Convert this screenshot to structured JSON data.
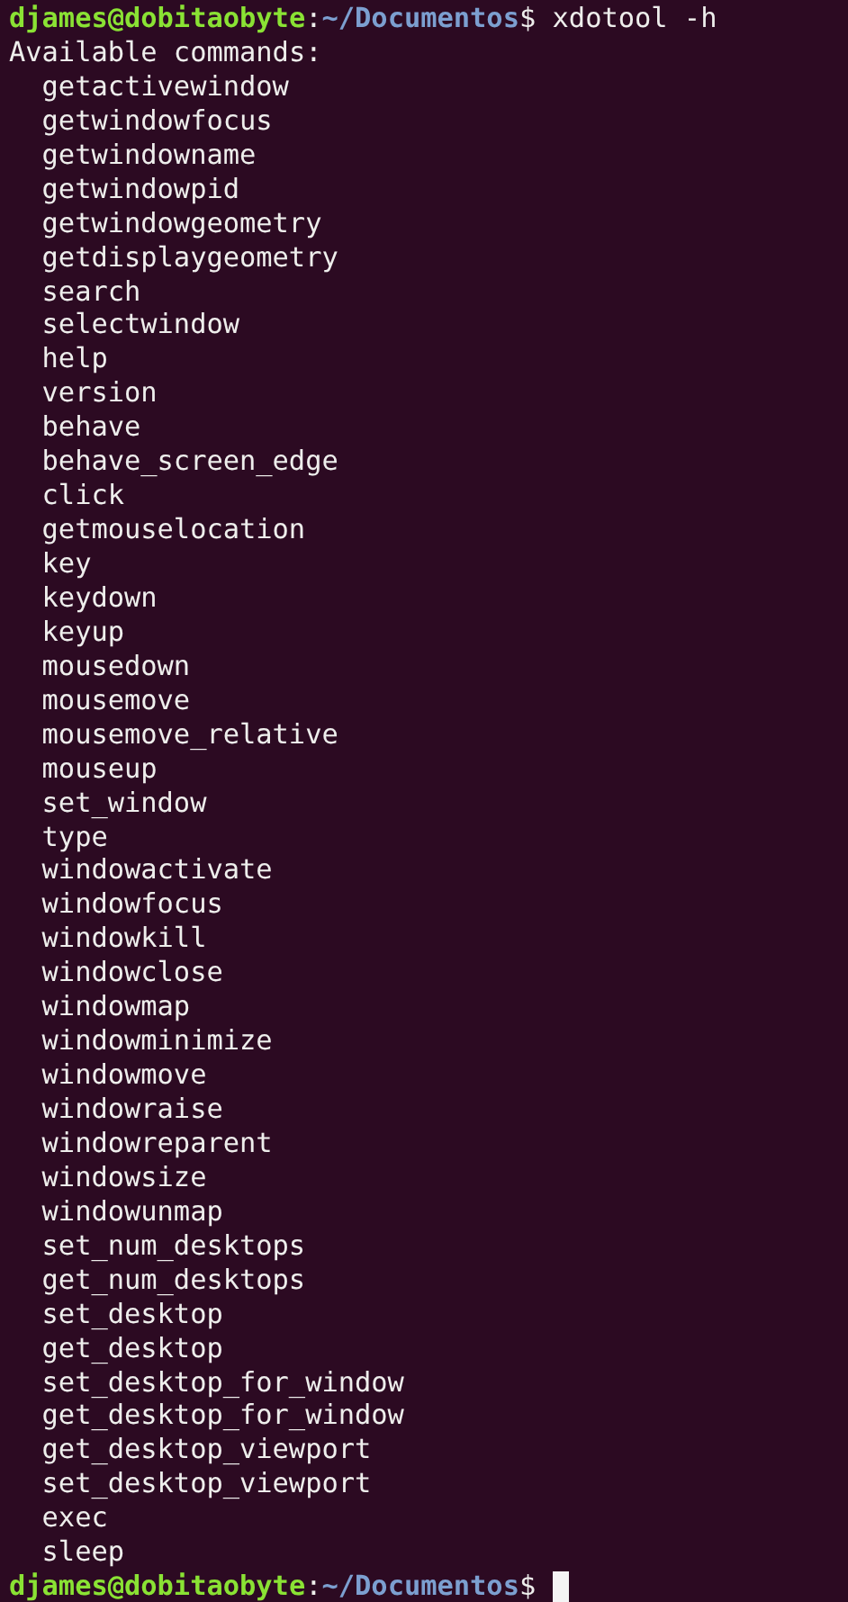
{
  "prompts": [
    {
      "user_host": "djames@dobitaobyte",
      "separator": ":",
      "path": "~/Documentos",
      "symbol": "$",
      "command": "xdotool -h"
    }
  ],
  "output_heading": "Available commands:",
  "commands": [
    "getactivewindow",
    "getwindowfocus",
    "getwindowname",
    "getwindowpid",
    "getwindowgeometry",
    "getdisplaygeometry",
    "search",
    "selectwindow",
    "help",
    "version",
    "behave",
    "behave_screen_edge",
    "click",
    "getmouselocation",
    "key",
    "keydown",
    "keyup",
    "mousedown",
    "mousemove",
    "mousemove_relative",
    "mouseup",
    "set_window",
    "type",
    "windowactivate",
    "windowfocus",
    "windowkill",
    "windowclose",
    "windowmap",
    "windowminimize",
    "windowmove",
    "windowraise",
    "windowreparent",
    "windowsize",
    "windowunmap",
    "set_num_desktops",
    "get_num_desktops",
    "set_desktop",
    "get_desktop",
    "set_desktop_for_window",
    "get_desktop_for_window",
    "get_desktop_viewport",
    "set_desktop_viewport",
    "exec",
    "sleep"
  ],
  "final_prompt": {
    "user_host": "djames@dobitaobyte",
    "separator": ":",
    "path": "~/Documentos",
    "symbol": "$",
    "cursor": true
  }
}
